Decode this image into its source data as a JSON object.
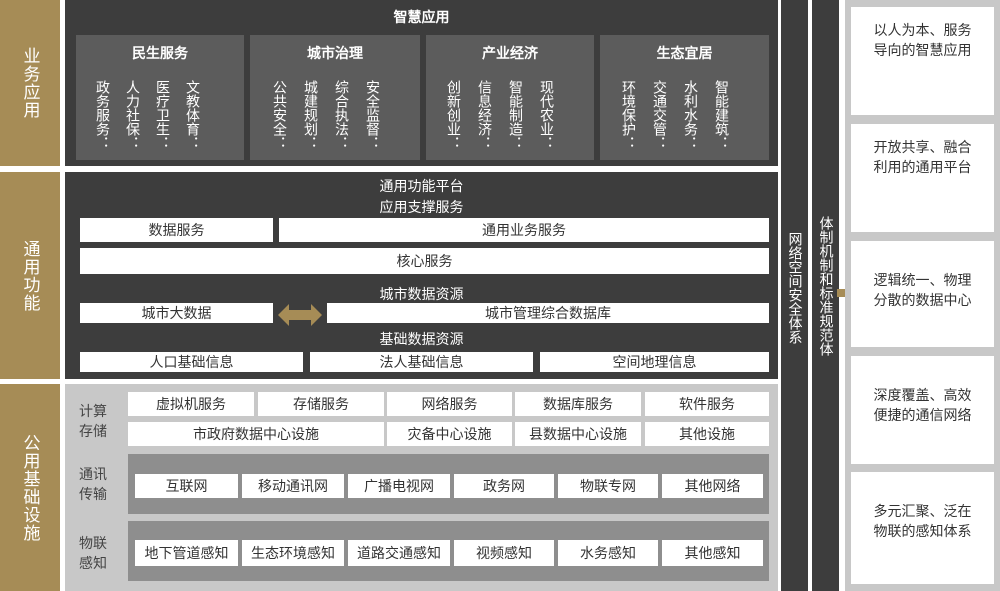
{
  "left_labels": [
    "业务应用",
    "通用功能",
    "公用基础设施"
  ],
  "top": {
    "title": "智慧应用",
    "groups": [
      {
        "title": "民生服务",
        "items": [
          "政务服务：",
          "人力社保：",
          "医疗卫生：",
          "文教体育："
        ]
      },
      {
        "title": "城市治理",
        "items": [
          "公共安全：",
          "城建规划：",
          "综合执法：",
          "安全监督："
        ]
      },
      {
        "title": "产业经济",
        "items": [
          "创新创业：",
          "信息经济：",
          "智能制造：",
          "现代农业："
        ]
      },
      {
        "title": "生态宜居",
        "items": [
          "环境保护：",
          "交通交管：",
          "水利水务：",
          "智能建筑："
        ]
      }
    ]
  },
  "middle": {
    "title": "通用功能平台",
    "app_support": "应用支撑服务",
    "data_service": "数据服务",
    "general_service": "通用业务服务",
    "core_service": "核心服务",
    "city_data": "城市数据资源",
    "big_data": "城市大数据",
    "mgmt_db": "城市管理综合数据库",
    "basic_data": "基础数据资源",
    "basic_items": [
      "人口基础信息",
      "法人基础信息",
      "空间地理信息"
    ]
  },
  "bottom": {
    "compute": {
      "label": "计算存储",
      "row1": [
        "虚拟机服务",
        "存储服务",
        "网络服务",
        "数据库服务",
        "软件服务"
      ],
      "row2": [
        "市政府数据中心设施",
        "灾备中心设施",
        "县数据中心设施",
        "其他设施"
      ]
    },
    "comm": {
      "label": "通讯传输",
      "items": [
        "互联网",
        "移动通讯网",
        "广播电视网",
        "政务网",
        "物联专网",
        "其他网络"
      ]
    },
    "iot": {
      "label": "物联感知",
      "items": [
        "地下管道感知",
        "生态环境感知",
        "道路交通感知",
        "视频感知",
        "水务感知",
        "其他感知"
      ]
    }
  },
  "bars": [
    "网络空间安全体系",
    "体制机制和标准规范体"
  ],
  "right_items": [
    [
      "以人为本、服务",
      "导向的智慧应用"
    ],
    [
      "开放共享、融合",
      "利用的通用平台"
    ],
    [
      "逻辑统一、物理",
      "分散的数据中心"
    ],
    [
      "深度覆盖、高效",
      "便捷的通信网络"
    ],
    [
      "多元汇聚、泛在",
      "物联的感知体系"
    ]
  ],
  "colors": {
    "gold": "#a68c56",
    "dark": "#3d3d3d",
    "panel": "#5c5c5c",
    "grey": "#c8c8c8"
  }
}
